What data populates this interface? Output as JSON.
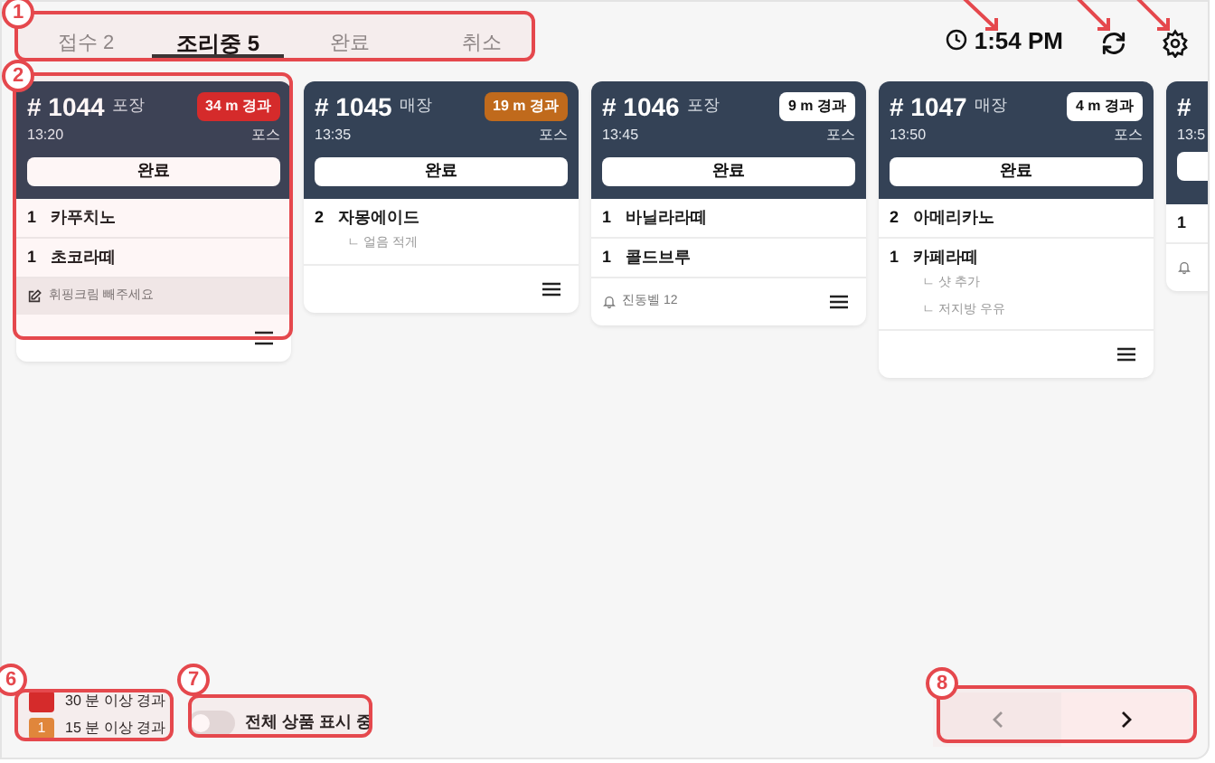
{
  "tabs": [
    {
      "label": "접수 2",
      "selected": false
    },
    {
      "label": "조리중 5",
      "selected": true
    },
    {
      "label": "완료",
      "selected": false
    },
    {
      "label": "취소",
      "selected": false
    }
  ],
  "clock": "1:54 PM",
  "orders": [
    {
      "number": "# 1044",
      "type": "포장",
      "elapsed": "34 m 경과",
      "kind": "over30",
      "time": "13:20",
      "source": "포스",
      "button": "완료",
      "items": [
        {
          "qty": "1",
          "name": "카푸치노"
        },
        {
          "qty": "1",
          "name": "초코라떼"
        }
      ],
      "note": {
        "kind": "memo",
        "text": "휘핑크림 빼주세요"
      }
    },
    {
      "number": "# 1045",
      "type": "매장",
      "elapsed": "19 m 경과",
      "kind": "over15",
      "time": "13:35",
      "source": "포스",
      "button": "완료",
      "items": [
        {
          "qty": "2",
          "name": "자몽에이드",
          "options": [
            "ㄴ 얼음 적게"
          ]
        }
      ]
    },
    {
      "number": "# 1046",
      "type": "포장",
      "elapsed": "9 m 경과",
      "kind": "normal",
      "time": "13:45",
      "source": "포스",
      "button": "완료",
      "items": [
        {
          "qty": "1",
          "name": "바닐라라떼"
        },
        {
          "qty": "1",
          "name": "콜드브루"
        }
      ],
      "note": {
        "kind": "bell",
        "text": "진동벨 12"
      }
    },
    {
      "number": "# 1047",
      "type": "매장",
      "elapsed": "4 m 경과",
      "kind": "normal",
      "time": "13:50",
      "source": "포스",
      "button": "완료",
      "items": [
        {
          "qty": "2",
          "name": "아메리카노"
        },
        {
          "qty": "1",
          "name": "카페라떼",
          "options": [
            "ㄴ 샷 추가",
            "ㄴ 저지방 우유"
          ]
        }
      ]
    },
    {
      "number": "#",
      "time": "13:5",
      "items": [
        {
          "qty": "1"
        }
      ],
      "note": {
        "kind": "bell"
      }
    }
  ],
  "legend": [
    {
      "kind": "over30",
      "label": "30 분 이상 경과"
    },
    {
      "kind": "over15",
      "swatch": "1",
      "label": "15 분 이상 경과"
    }
  ],
  "toggle": {
    "label": "전체 상품 표시 중",
    "on": false
  },
  "pager": {
    "prev_disabled": true,
    "next_disabled": false
  },
  "callouts": [
    {
      "label": "1"
    },
    {
      "label": "2"
    },
    {
      "label": "6"
    },
    {
      "label": "7"
    },
    {
      "label": "8"
    }
  ]
}
